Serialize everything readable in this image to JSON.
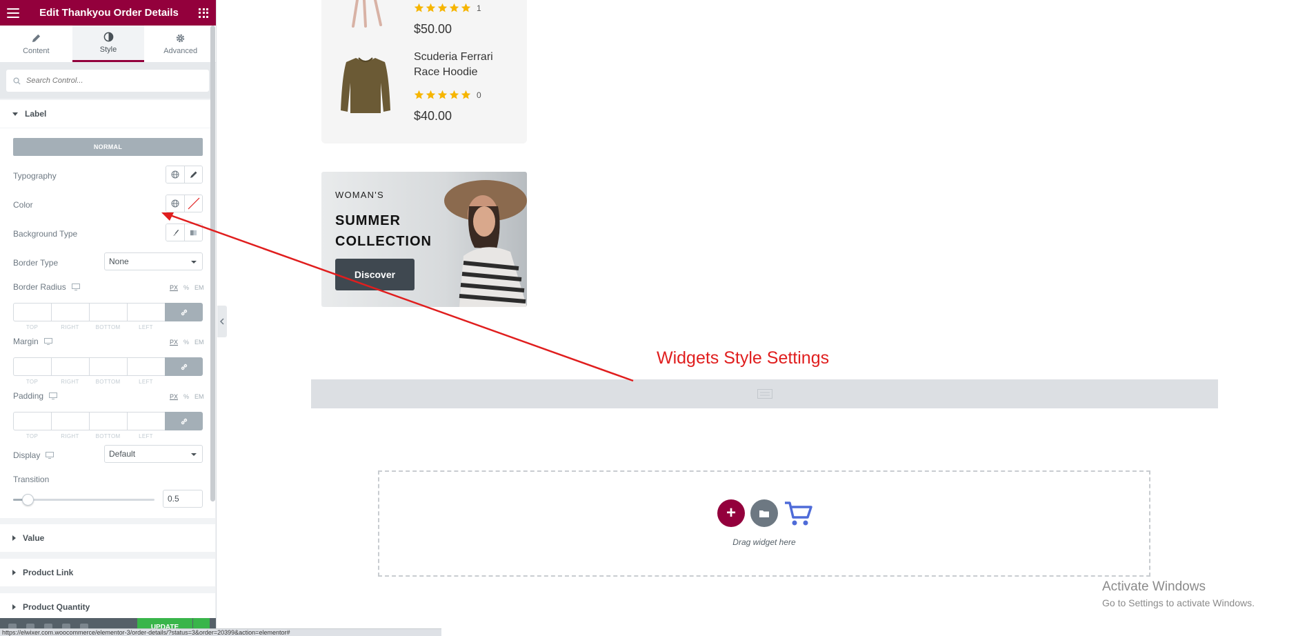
{
  "panel": {
    "title": "Edit Thankyou Order Details",
    "tabs": [
      {
        "label": "Content",
        "icon": "pencil-icon"
      },
      {
        "label": "Style",
        "icon": "contrast-icon"
      },
      {
        "label": "Advanced",
        "icon": "gear-icon"
      }
    ],
    "search_placeholder": "Search Control...",
    "sections": {
      "label": "Label",
      "value": "Value",
      "product_link": "Product Link",
      "product_quantity": "Product Quantity"
    },
    "normal_button": "NORMAL",
    "controls": {
      "typography": "Typography",
      "color": "Color",
      "background_type": "Background Type",
      "border_type": "Border Type",
      "border_type_value": "None",
      "border_radius": "Border Radius",
      "margin": "Margin",
      "padding": "Padding",
      "display": "Display",
      "display_value": "Default",
      "transition": "Transition",
      "transition_value": "0.5",
      "transition_fraction": 0.1
    },
    "units": [
      "PX",
      "%",
      "EM"
    ],
    "dimension_labels": [
      "TOP",
      "RIGHT",
      "BOTTOM",
      "LEFT"
    ],
    "update_button": "UPDATE",
    "accent_color": "#93003c"
  },
  "statusbar_url": "https://elwixer.com.woocommerce/elementor-3/order-details/?status=3&order=20399&action=elementor#",
  "canvas": {
    "products": [
      {
        "name": "",
        "rating_count": "1",
        "price": "$50.00"
      },
      {
        "name": "Scuderia Ferrari Race Hoodie",
        "rating_count": "0",
        "price": "$40.00"
      }
    ],
    "banner": {
      "kicker": "WOMAN'S",
      "title": "SUMMER COLLECTION",
      "button": "Discover"
    },
    "annotation": "Widgets Style Settings",
    "drop_zone_text": "Drag widget here",
    "windows_activation": {
      "title": "Activate Windows",
      "subtitle": "Go to Settings to activate Windows."
    }
  }
}
